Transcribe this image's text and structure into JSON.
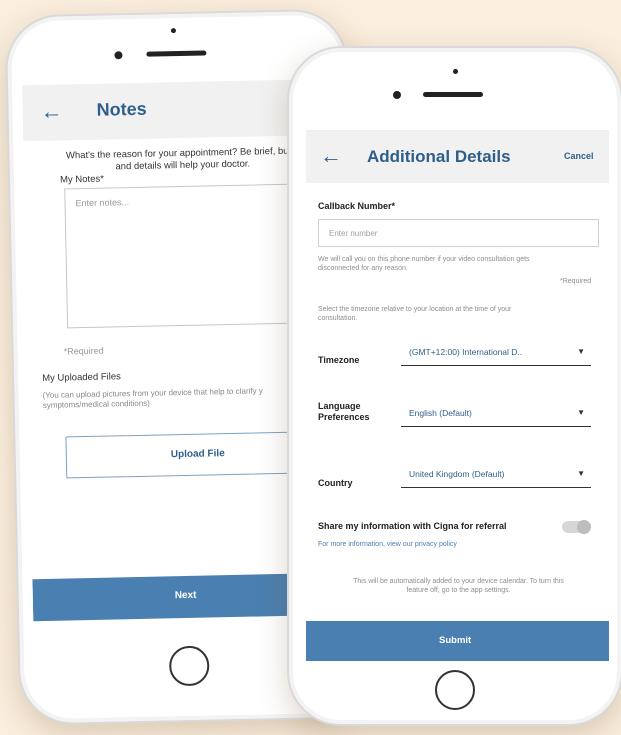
{
  "notes_screen": {
    "title": "Notes",
    "intro_line1": "What's the reason for your appointment? Be brief, but a",
    "intro_line2": "and details will help your doctor.",
    "notes_label": "My Notes*",
    "notes_placeholder": "Enter notes...",
    "required": "*Required",
    "uploaded_files_label": "My Uploaded Files",
    "upload_help_line1": "(You can upload pictures from your device that help to clarify y",
    "upload_help_line2": "symptoms/medical conditions)",
    "upload_button": "Upload File",
    "next_button": "Next"
  },
  "details_screen": {
    "title": "Additional Details",
    "cancel": "Cancel",
    "callback_label": "Callback Number*",
    "callback_placeholder": "Enter number",
    "callback_help_line1": "We will call you on this phone number if your video consultation gets",
    "callback_help_line2": "disconnected for any reason.",
    "required": "*Required",
    "timezone_help_line1": "Select the timezone relative to your location at the time of your",
    "timezone_help_line2": "consultation.",
    "timezone_label": "Timezone",
    "timezone_value": "(GMT+12:00) International D..",
    "language_label_line1": "Language",
    "language_label_line2": "Preferences",
    "language_value": "English (Default)",
    "country_label": "Country",
    "country_value": "United Kingdom  (Default)",
    "share_label": "Share my information with Cigna for referral",
    "privacy_link": "For more information, view our privacy policy",
    "calendar_note_line1": "This will be automatically added to your device calendar. To turn this",
    "calendar_note_line2": "feature off, go to the app settings.",
    "submit_button": "Submit"
  },
  "icons": {
    "back": "←",
    "dropdown": "▼"
  },
  "colors": {
    "accent": "#2e5f8a",
    "button": "#4a7fb1",
    "background": "#fbeede"
  }
}
